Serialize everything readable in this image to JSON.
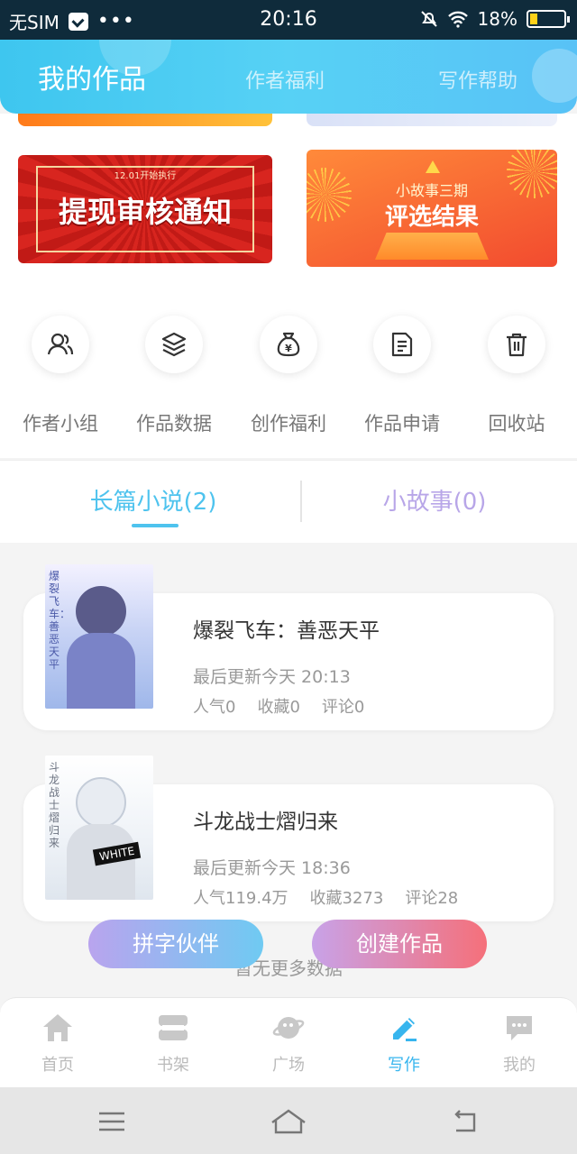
{
  "status_bar": {
    "carrier": "无SIM",
    "dots": "•••",
    "time": "20:16",
    "battery": "18%"
  },
  "header": {
    "tabs": [
      {
        "label": "我的作品",
        "active": true
      },
      {
        "label": "作者福利",
        "active": false
      },
      {
        "label": "写作帮助",
        "active": false
      }
    ]
  },
  "banners": {
    "left": {
      "small": "12.01开始执行",
      "title": "提现审核通知"
    },
    "right": {
      "line1": "小故事三期",
      "line2": "评选结果"
    }
  },
  "quick_actions": [
    {
      "label": "作者小组",
      "icon": "group-icon"
    },
    {
      "label": "作品数据",
      "icon": "layers-icon"
    },
    {
      "label": "创作福利",
      "icon": "money-bag-icon"
    },
    {
      "label": "作品申请",
      "icon": "document-icon"
    },
    {
      "label": "回收站",
      "icon": "trash-icon"
    }
  ],
  "tabs": {
    "novel": "长篇小说(2)",
    "story": "小故事(0)"
  },
  "works": [
    {
      "title": "爆裂飞车：善恶天平",
      "updated": "最后更新今天 20:13",
      "popularity": "人气0",
      "favorites": "收藏0",
      "comments": "评论0",
      "cover_text": "爆裂飞车：善恶天平"
    },
    {
      "title": "斗龙战士熠归来",
      "updated": "最后更新今天 18:36",
      "popularity": "人气119.4万",
      "favorites": "收藏3273",
      "comments": "评论28",
      "cover_text": "斗龙战士熠归来",
      "cover_tag": "WHITE"
    }
  ],
  "footer_note": "暂无更多数据",
  "fab": {
    "partner": "拼字伙伴",
    "create": "创建作品"
  },
  "tabbar": [
    {
      "label": "首页",
      "icon": "home-icon",
      "active": false
    },
    {
      "label": "书架",
      "icon": "bookshelf-icon",
      "active": false
    },
    {
      "label": "广场",
      "icon": "planet-icon",
      "active": false
    },
    {
      "label": "写作",
      "icon": "pen-icon",
      "active": true
    },
    {
      "label": "我的",
      "icon": "chat-icon",
      "active": false
    }
  ],
  "colors": {
    "accent": "#4ec3ee",
    "header": "#57d1f5",
    "story_tab": "#b8a6e8"
  }
}
